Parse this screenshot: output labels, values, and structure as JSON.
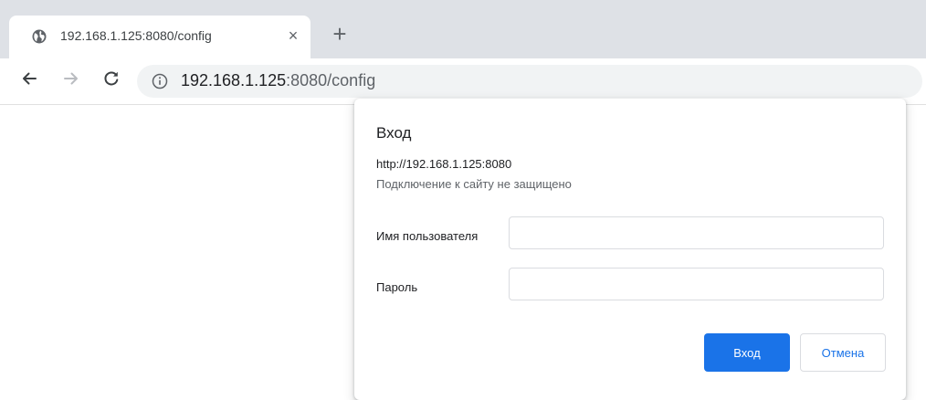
{
  "tab": {
    "title": "192.168.1.125:8080/config",
    "favicon_icon": "globe-icon",
    "close_symbol": "×"
  },
  "toolbar": {
    "new_tab_symbol": "+",
    "back_icon": "arrow-left-icon",
    "forward_icon": "arrow-right-icon",
    "reload_icon": "reload-icon",
    "info_icon": "info-circle-icon"
  },
  "omnibox": {
    "url_host": "192.168.1.125",
    "url_rest": ":8080/config"
  },
  "dialog": {
    "title": "Вход",
    "origin": "http://192.168.1.125:8080",
    "warning": "Подключение к сайту не защищено",
    "username_label": "Имя пользователя",
    "username_value": "",
    "password_label": "Пароль",
    "password_value": "",
    "signin_label": "Вход",
    "cancel_label": "Отмена"
  },
  "colors": {
    "accent": "#1a73e8",
    "tabstrip_bg": "#dee1e6",
    "omnibox_bg": "#f1f3f4"
  }
}
